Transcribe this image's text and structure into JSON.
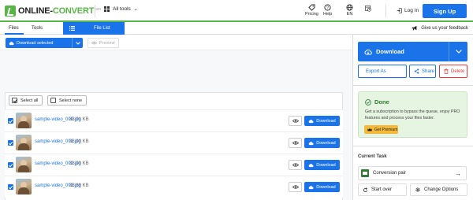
{
  "header": {
    "logo_prefix": "ONLINE-",
    "logo_main": "CONVERT",
    "logo_suffix": ".com",
    "all_tools": "All tools",
    "pricing": "Pricing",
    "help": "Help",
    "language": "EN",
    "login": "Log In",
    "signup": "Sign Up"
  },
  "tabs": {
    "files": "Files",
    "tools": "Tools",
    "file_list": "File List"
  },
  "toolbar": {
    "download_selected": "Download selected",
    "preview": "Preview"
  },
  "selection": {
    "select_all": "Select all",
    "select_none": "Select none"
  },
  "files": [
    {
      "name": "sample-video_000.jpg",
      "size": "88.91 KB",
      "download": "Download"
    },
    {
      "name": "sample-video_001.jpg",
      "size": "88.90 KB",
      "download": "Download"
    },
    {
      "name": "sample-video_002.jpg",
      "size": "88.90 KB",
      "download": "Download"
    },
    {
      "name": "sample-video_003.jpg",
      "size": "88.88 KB",
      "download": "Download"
    }
  ],
  "right_panel": {
    "feedback": "Give us your feedback",
    "download": "Download",
    "export_as": "Export As",
    "share": "Share",
    "delete": "Delete",
    "done_title": "Done",
    "done_text": "Get a subscription to bypass the queue, enjoy PRO features and process your files faster.",
    "get_premium": "Get Premium",
    "current_task": "Current Task",
    "conversion_pair": "Conversion pair",
    "start_over": "Start over",
    "change_options": "Change Options"
  },
  "colors": {
    "brand_green": "#58b646",
    "primary_blue": "#1a73e8",
    "delete_red": "#e53935",
    "done_bg": "#e6f4e2",
    "premium_yellow": "#f5b93a"
  }
}
